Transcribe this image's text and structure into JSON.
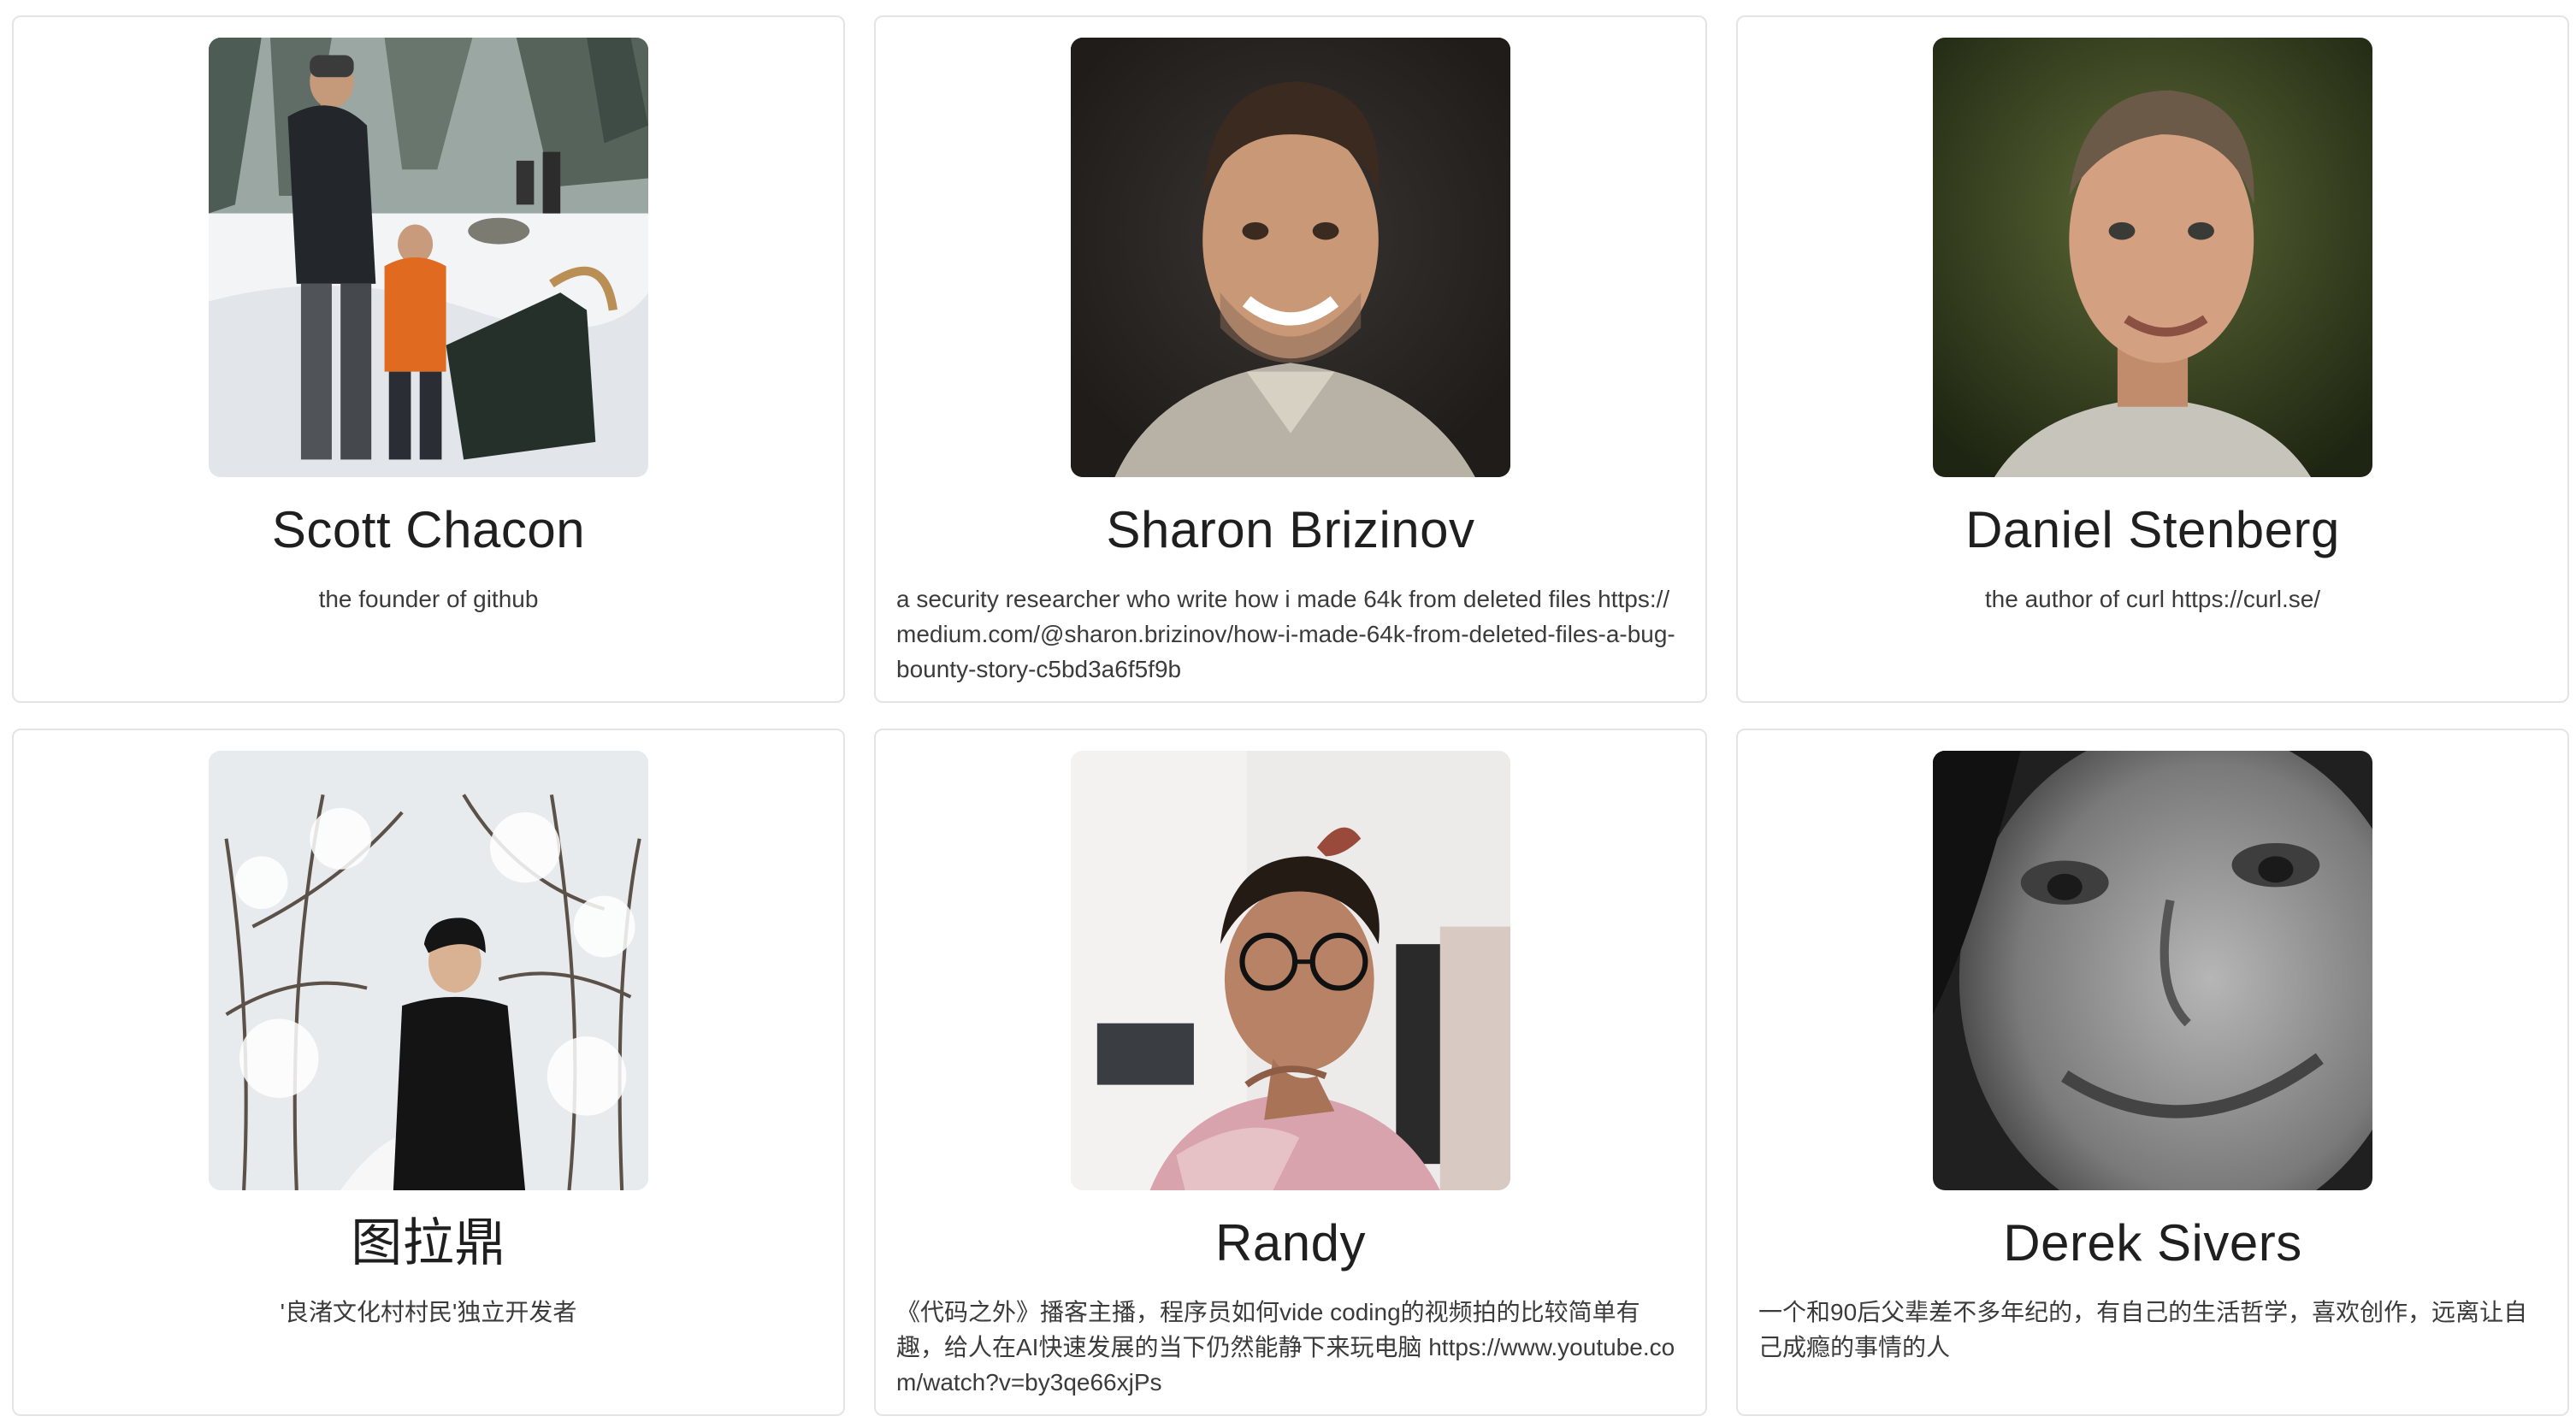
{
  "people": [
    {
      "name": "Scott Chacon",
      "bio": "the founder of github",
      "photo": "person-in-snow-with-child-and-dog-sled"
    },
    {
      "name": "Sharon Brizinov",
      "bio": "a security researcher who write how i made 64k from deleted files https://medium.com/@sharon.brizinov/how-i-made-64k-from-deleted-files-a-bug-bounty-story-c5bd3a6f5f9b",
      "photo": "smiling-man-portrait-dark-background"
    },
    {
      "name": "Daniel Stenberg",
      "bio": "the author of curl https://curl.se/",
      "photo": "smiling-man-portrait-green-background"
    },
    {
      "name": "图拉鼎",
      "bio": "'良渚文化村村民'独立开发者",
      "photo": "person-in-snowy-forest"
    },
    {
      "name": "Randy",
      "bio": "《代码之外》播客主播，程序员如何vide coding的视频拍的比较简单有趣，给人在AI快速发展的当下仍然能静下来玩电脑 https://www.youtube.com/watch?v=by3qe66xjPs",
      "photo": "man-with-glasses-hand-on-chin"
    },
    {
      "name": "Derek Sivers",
      "bio": "一个和90后父辈差不多年纪的，有自己的生活哲学，喜欢创作，远离让自己成瘾的事情的人",
      "photo": "black-and-white-smiling-face-closeup"
    }
  ]
}
